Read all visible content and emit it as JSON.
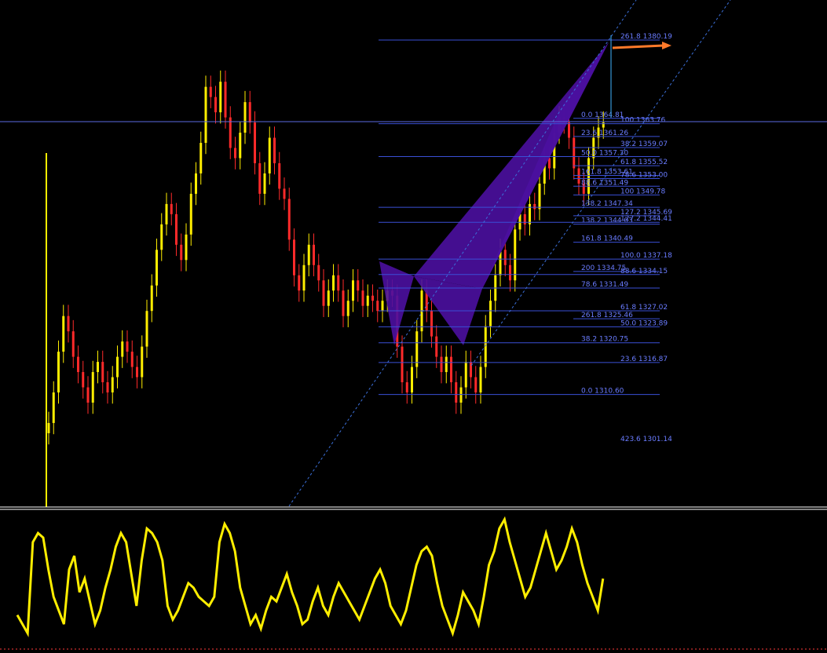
{
  "colors": {
    "background": "#000000",
    "bull_candle": "#ffee00",
    "bear_candle": "#ff2a2a",
    "fib_line": "#3a4fd6",
    "fib_label": "#6a7cff",
    "pattern_fill": "#4b0fa0",
    "horizontal_line": "#5a6ae0",
    "channel": "#3b6fd9",
    "projection_arrow": "#ff7a2a",
    "oscillator": "#ffee00",
    "separator": "#ffffff"
  },
  "chart_data": {
    "type": "candlestick",
    "price_range": [
      1301.14,
      1380.19
    ],
    "fib_levels": [
      {
        "label": "261.8 1380.19",
        "price": 1380.19
      },
      {
        "label": "0.0 1364.81",
        "price": 1364.81
      },
      {
        "label": "100 1363.76",
        "price": 1363.76
      },
      {
        "label": "23.6 1361.26",
        "price": 1361.26
      },
      {
        "label": "38.2 1359.07",
        "price": 1359.07
      },
      {
        "label": "50.0 1357.30",
        "price": 1357.3
      },
      {
        "label": "61.8 1355.52",
        "price": 1355.52
      },
      {
        "label": "161.8 1353.61",
        "price": 1353.61
      },
      {
        "label": "78.6 1353.00",
        "price": 1353.0
      },
      {
        "label": "88.6 1351.49",
        "price": 1351.49
      },
      {
        "label": "100 1349.78",
        "price": 1349.78
      },
      {
        "label": "138.2 1347.34",
        "price": 1347.34
      },
      {
        "label": "127.2 1345.69",
        "price": 1345.69
      },
      {
        "label": "138.2 1344.03",
        "price": 1344.03
      },
      {
        "label": "127.2 1344.41",
        "price": 1344.41
      },
      {
        "label": "161.8 1340.49",
        "price": 1340.49
      },
      {
        "label": "100.0 1337.18",
        "price": 1337.18
      },
      {
        "label": "200 1334.75",
        "price": 1334.75
      },
      {
        "label": "88.6 1334.15",
        "price": 1334.15
      },
      {
        "label": "78.6 1331.49",
        "price": 1331.49
      },
      {
        "label": "61.8 1327.02",
        "price": 1327.02
      },
      {
        "label": "261.8 1325.46",
        "price": 1325.46
      },
      {
        "label": "50.0 1323.89",
        "price": 1323.89
      },
      {
        "label": "38.2 1320.75",
        "price": 1320.75
      },
      {
        "label": "23.6 1316.87",
        "price": 1316.87
      },
      {
        "label": "0.0 1310.60",
        "price": 1310.6
      },
      {
        "label": "423.6 1301.14",
        "price": 1301.14
      }
    ],
    "candle_closes": [
      1305,
      1311,
      1319,
      1326,
      1323,
      1318,
      1315,
      1312,
      1309,
      1315,
      1317,
      1313,
      1311,
      1314,
      1318,
      1321,
      1319,
      1316,
      1314,
      1320,
      1327,
      1332,
      1339,
      1344,
      1348,
      1346,
      1340,
      1337,
      1342,
      1350,
      1354,
      1360,
      1371,
      1369,
      1366,
      1372,
      1365,
      1359,
      1357,
      1362,
      1368,
      1364,
      1356,
      1350,
      1354,
      1361,
      1356,
      1351,
      1349,
      1341,
      1334,
      1331,
      1336,
      1340,
      1336,
      1333,
      1328,
      1331,
      1334,
      1331,
      1326,
      1329,
      1333,
      1331,
      1328,
      1330,
      1329,
      1327,
      1329,
      1331,
      1330,
      1320,
      1313,
      1311,
      1316,
      1323,
      1331,
      1327,
      1322,
      1318,
      1315,
      1318,
      1313,
      1309,
      1312,
      1317,
      1314,
      1311,
      1316,
      1324,
      1329,
      1334,
      1339,
      1336,
      1333,
      1343,
      1346,
      1344,
      1348,
      1347,
      1352,
      1357,
      1355,
      1362,
      1365,
      1364,
      1361,
      1355,
      1352,
      1350,
      1357,
      1361,
      1363,
      1364
    ],
    "oscillator": [
      8,
      6,
      4,
      24,
      26,
      25,
      18,
      12,
      9,
      6,
      18,
      21,
      13,
      16,
      11,
      6,
      9,
      14,
      18,
      23,
      26,
      24,
      17,
      10,
      20,
      27,
      26,
      24,
      20,
      10,
      7,
      9,
      12,
      15,
      14,
      12,
      11,
      10,
      12,
      24,
      28,
      26,
      22,
      14,
      10,
      6,
      8,
      5,
      9,
      12,
      11,
      14,
      17,
      13,
      10,
      6,
      7,
      11,
      14,
      10,
      8,
      12,
      15,
      13,
      11,
      9,
      7,
      10,
      13,
      16,
      18,
      15,
      10,
      8,
      6,
      9,
      14,
      19,
      22,
      23,
      21,
      15,
      10,
      7,
      4,
      8,
      13,
      11,
      9,
      6,
      12,
      19,
      22,
      27,
      29,
      24,
      20,
      16,
      12,
      14,
      18,
      22,
      26,
      22,
      18,
      20,
      23,
      27,
      24,
      19,
      15,
      12,
      9,
      16
    ]
  }
}
